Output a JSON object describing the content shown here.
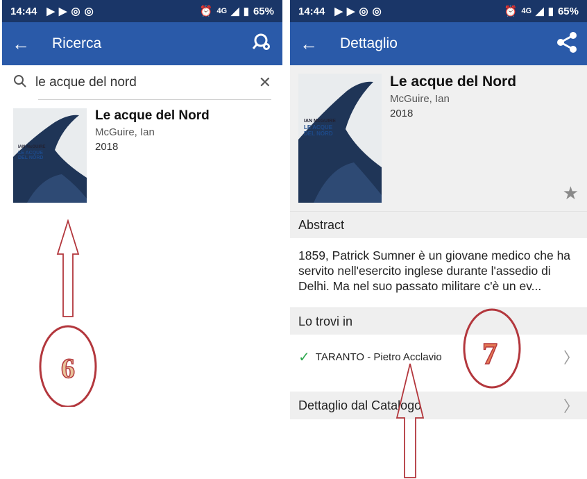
{
  "left": {
    "status": {
      "time": "14:44",
      "battery": "65%",
      "network": "4G"
    },
    "appbar": {
      "title": "Ricerca"
    },
    "search": {
      "value": "le acque del nord"
    },
    "result": {
      "title": "Le acque del Nord",
      "author": "McGuire, Ian",
      "year": "2018",
      "cover_author": "IAN McGUIRE",
      "cover_title1": "LE ACQUE",
      "cover_title2": "DEL NORD"
    },
    "annotation_number": "6"
  },
  "right": {
    "status": {
      "time": "14:44",
      "battery": "65%",
      "network": "4G"
    },
    "appbar": {
      "title": "Dettaglio"
    },
    "book": {
      "title": "Le acque del Nord",
      "author": "McGuire, Ian",
      "year": "2018",
      "cover_author": "IAN McGUIRE",
      "cover_title1": "LE ACQUE",
      "cover_title2": "DEL NORD"
    },
    "abstract_header": "Abstract",
    "abstract_text": "1859, Patrick Sumner è un giovane medico che ha servito nell'esercito inglese durante l'assedio di Delhi. Ma nel suo passato militare c'è un ev...",
    "location_header": "Lo trovi in",
    "location": "TARANTO - Pietro Acclavio",
    "catalog_label": "Dettaglio dal Catalogo",
    "annotation_number": "7"
  },
  "colors": {
    "statusbar": "#1a3668",
    "appbar": "#2a5aa9",
    "annotation": "#b3373d"
  }
}
